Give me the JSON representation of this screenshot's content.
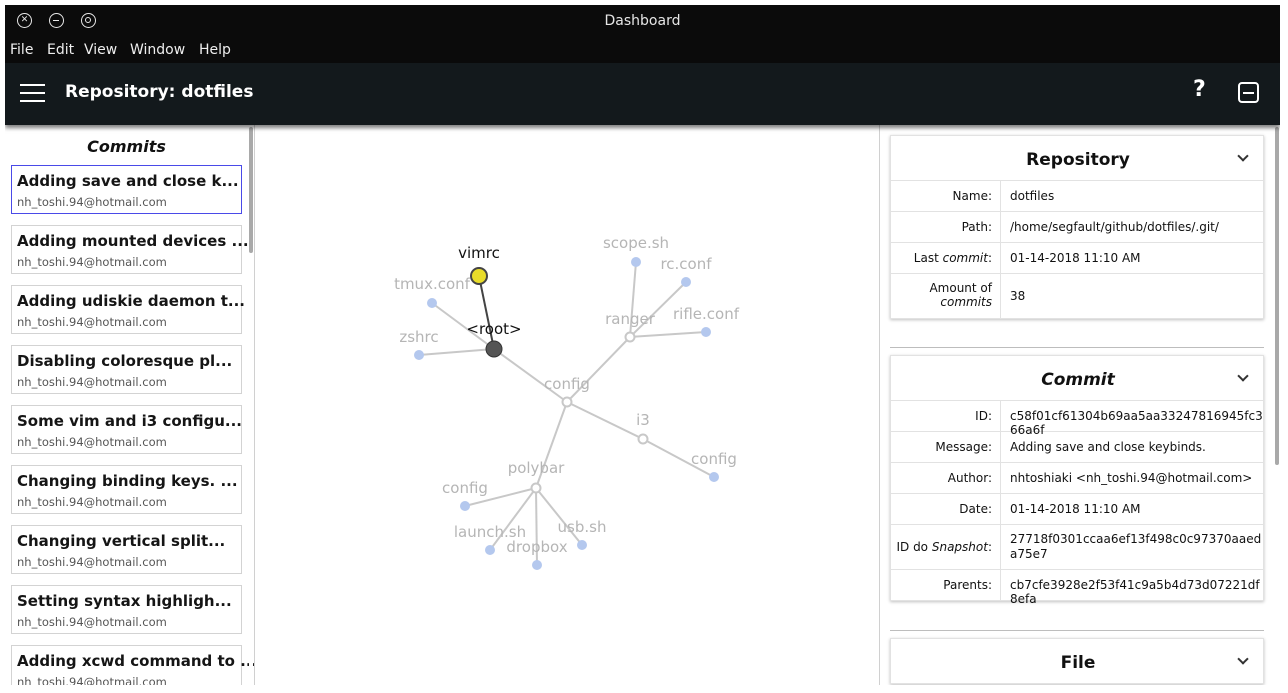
{
  "window": {
    "title": "Dashboard"
  },
  "menu": {
    "items": [
      "File",
      "Edit",
      "View",
      "Window",
      "Help"
    ]
  },
  "appbar": {
    "title": "Repository: dotfiles",
    "help_label": "?"
  },
  "commits": {
    "title": "Commits",
    "items": [
      {
        "message": "Adding save and close k...",
        "author": "nh_toshi.94@hotmail.com"
      },
      {
        "message": "Adding mounted devices ...",
        "author": "nh_toshi.94@hotmail.com"
      },
      {
        "message": "Adding udiskie daemon t...",
        "author": "nh_toshi.94@hotmail.com"
      },
      {
        "message": "Disabling coloresque pl...",
        "author": "nh_toshi.94@hotmail.com"
      },
      {
        "message": "Some vim and i3 configu...",
        "author": "nh_toshi.94@hotmail.com"
      },
      {
        "message": "Changing binding keys. ...",
        "author": "nh_toshi.94@hotmail.com"
      },
      {
        "message": "Changing vertical split...",
        "author": "nh_toshi.94@hotmail.com"
      },
      {
        "message": "Setting syntax highligh...",
        "author": "nh_toshi.94@hotmail.com"
      },
      {
        "message": "Adding xcwd command to ...",
        "author": "nh_toshi.94@hotmail.com"
      }
    ]
  },
  "graph": {
    "colors": {
      "edge": "#c8c8c8",
      "edge_active": "#444444",
      "leaf": "#b4c8ee",
      "selected": "#e8dc2a",
      "root": "#555555",
      "label": "#b5b5b5",
      "label_active": "#111111"
    },
    "nodes": {
      "root": "<root>",
      "vimrc": "vimrc",
      "tmux": "tmux.conf",
      "zshrc": "zshrc",
      "config": "config",
      "ranger": "ranger",
      "scope": "scope.sh",
      "rcconf": "rc.conf",
      "rifle": "rifle.conf",
      "i3": "i3",
      "i3config": "config",
      "polybar": "polybar",
      "pconfig": "config",
      "launch": "launch.sh",
      "dropbox": "dropbox",
      "usb": "usb.sh"
    }
  },
  "repository": {
    "title": "Repository",
    "rows": [
      {
        "key": "Name:",
        "value": "dotfiles"
      },
      {
        "key": "Path:",
        "value": "/home/segfault/github/dotfiles/.git/"
      },
      {
        "key_prefix": "Last ",
        "key_em": "commit",
        "key_suffix": ":",
        "value": "01-14-2018 11:10 AM"
      },
      {
        "key_prefix": "Amount of",
        "key_em": "commits",
        "value": "38"
      }
    ]
  },
  "commit": {
    "title": "Commit",
    "rows": [
      {
        "key": "ID:",
        "value": "c58f01cf61304b69aa5aa33247816945fc366a6f"
      },
      {
        "key": "Message:",
        "value": "Adding save and close keybinds."
      },
      {
        "key": "Author:",
        "value": "nhtoshiaki <nh_toshi.94@hotmail.com>"
      },
      {
        "key": "Date:",
        "value": "01-14-2018 11:10 AM"
      },
      {
        "key_prefix": "ID do ",
        "key_em": "Snapshot",
        "key_suffix": ":",
        "value": "27718f0301ccaa6ef13f498c0c97370aaeda75e7"
      },
      {
        "key": "Parents:",
        "value": "cb7cfe3928e2f53f41c9a5b4d73d07221df8efa"
      }
    ]
  },
  "file": {
    "title": "File"
  }
}
